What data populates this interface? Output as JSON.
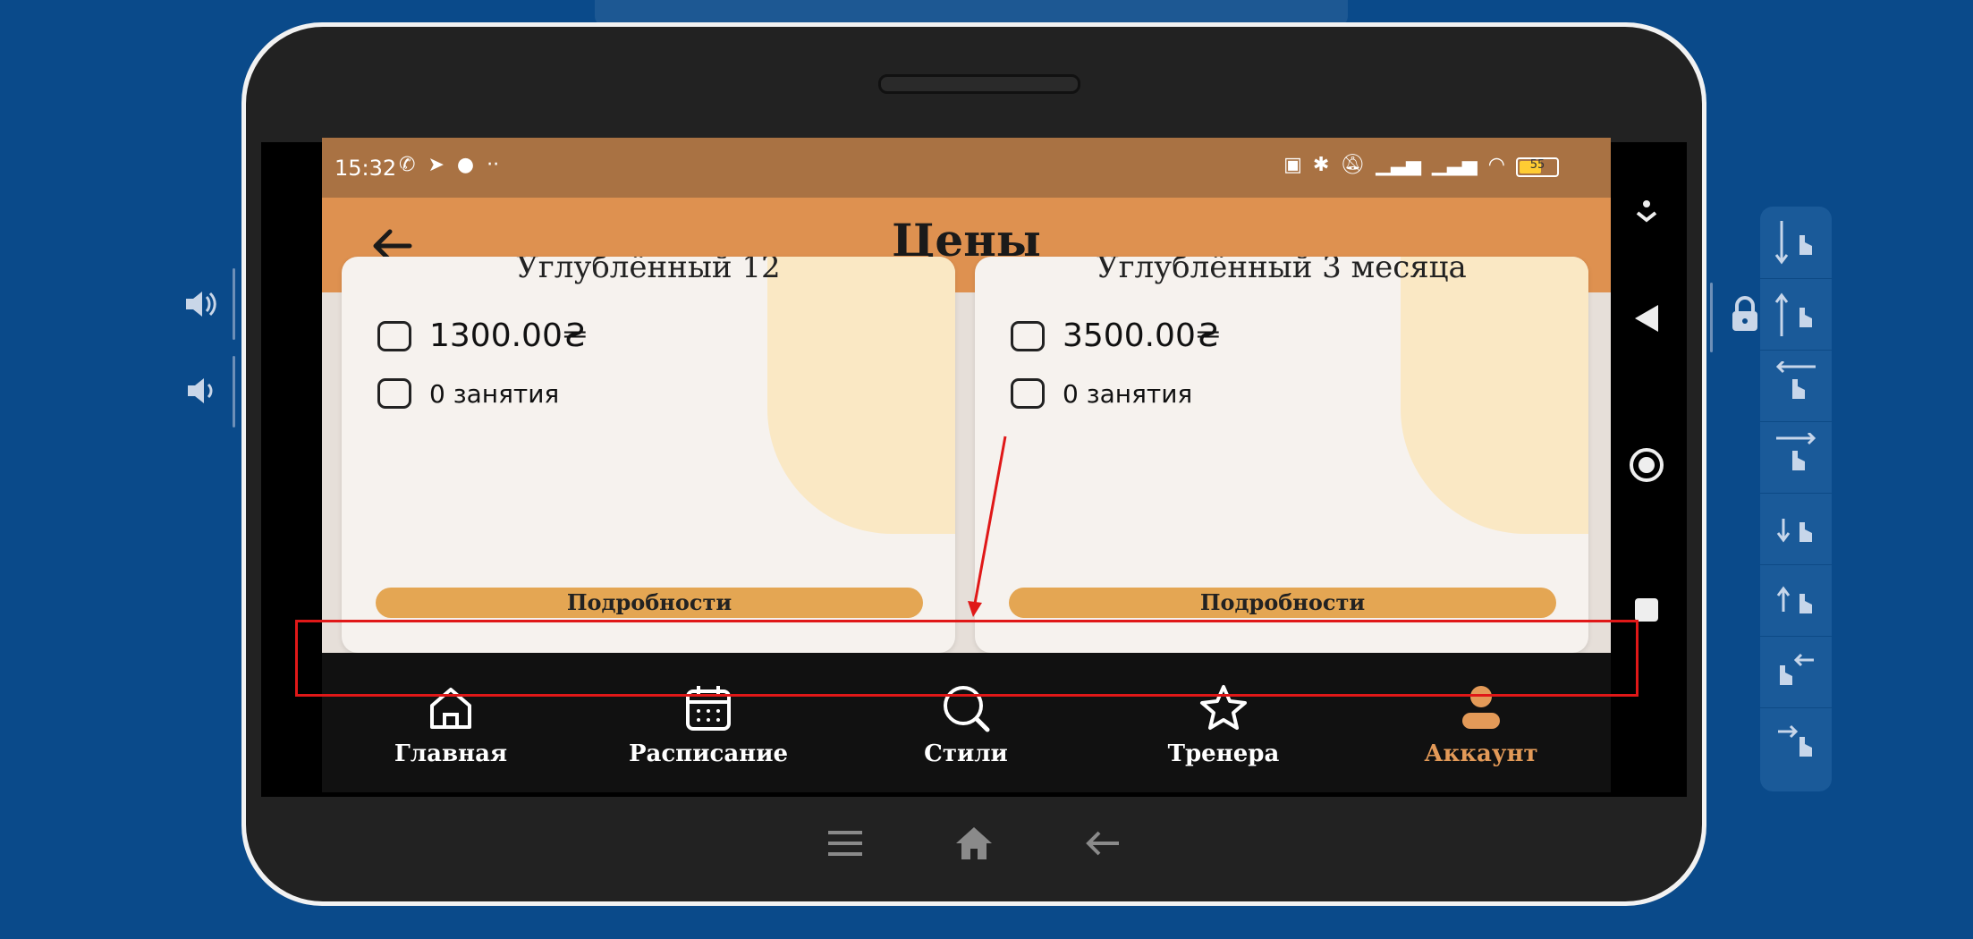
{
  "status_bar": {
    "time": "15:32",
    "battery": "55",
    "left_icons": [
      "viber-icon",
      "telegram-icon",
      "music-icon",
      "more-dots-icon"
    ],
    "right_icons": [
      "nfc-icon",
      "bluetooth-icon",
      "mute-icon",
      "signal-icon",
      "signal-icon",
      "wifi-icon",
      "battery-icon"
    ]
  },
  "app_bar": {
    "title": "Цены",
    "back_icon": "back-arrow-icon"
  },
  "cards": [
    {
      "title_partial": "Углублённый 12",
      "price": "1300.00₴",
      "lessons": "0 занятия",
      "details_label": "Подробности"
    },
    {
      "title_partial": "Углублённый 3 месяца",
      "price": "3500.00₴",
      "lessons": "0 занятия",
      "details_label": "Подробности"
    }
  ],
  "bottom_nav": [
    {
      "label": "Главная",
      "icon": "home-icon",
      "active": false
    },
    {
      "label": "Расписание",
      "icon": "calendar-icon",
      "active": false
    },
    {
      "label": "Стили",
      "icon": "search-icon",
      "active": false
    },
    {
      "label": "Тренера",
      "icon": "star-icon",
      "active": false
    },
    {
      "label": "Аккаунт",
      "icon": "account-icon",
      "active": true
    }
  ],
  "colors": {
    "status_bar": "#a97243",
    "app_bar": "#de9150",
    "active_nav": "#e39a58",
    "details_button": "#e4a653",
    "desktop_bg": "#0a4a8a",
    "annotation": "#e01818"
  }
}
